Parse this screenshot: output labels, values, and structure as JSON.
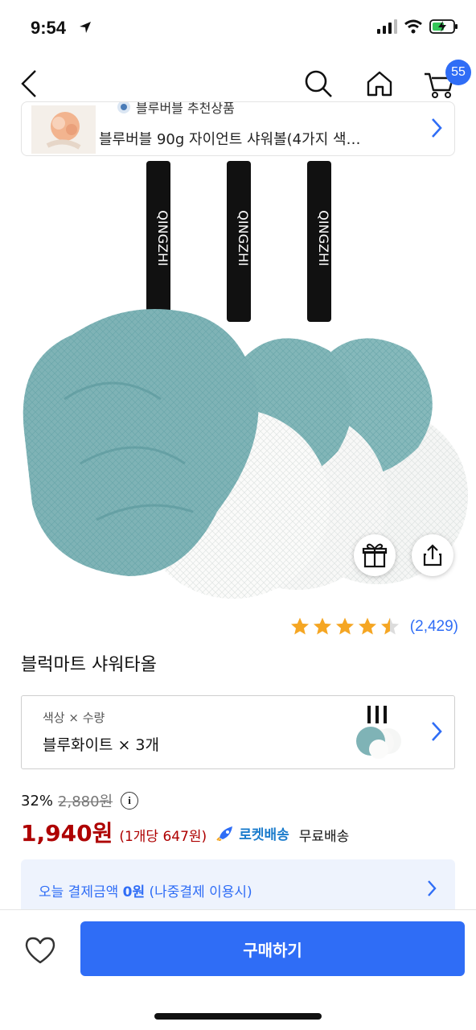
{
  "status_bar": {
    "time": "9:54"
  },
  "nav": {
    "cart_count": "55"
  },
  "related": {
    "brand": "블루버블 추천상품",
    "title": "블루버블 90g 자이언트 샤워볼(4가지 색…"
  },
  "product_image": {
    "strap_text": "QINGZHI"
  },
  "rating": {
    "stars": 4.5,
    "count": "(2,429)"
  },
  "product": {
    "title": "블럭마트 샤워타올"
  },
  "option": {
    "label": "색상 × 수량",
    "value": "블루화이트 × 3개"
  },
  "price": {
    "discount": "32%",
    "original": "2,880원",
    "sale": "1,940원",
    "unit": "(1개당 647원)",
    "rocket_label": "로켓배송",
    "shipping": "무료배송"
  },
  "later_pay": {
    "prefix": "오늘 결제금액 ",
    "amount": "0원",
    "service": " (나중결제",
    "suffix": " 이용시)"
  },
  "bottom": {
    "buy_label": "구매하기"
  },
  "colors": {
    "accent": "#2f6df6",
    "price_red": "#ae0000",
    "rocket_blue": "#1b7ccc",
    "teal": "#7fb3b6",
    "star": "#f5a623"
  }
}
